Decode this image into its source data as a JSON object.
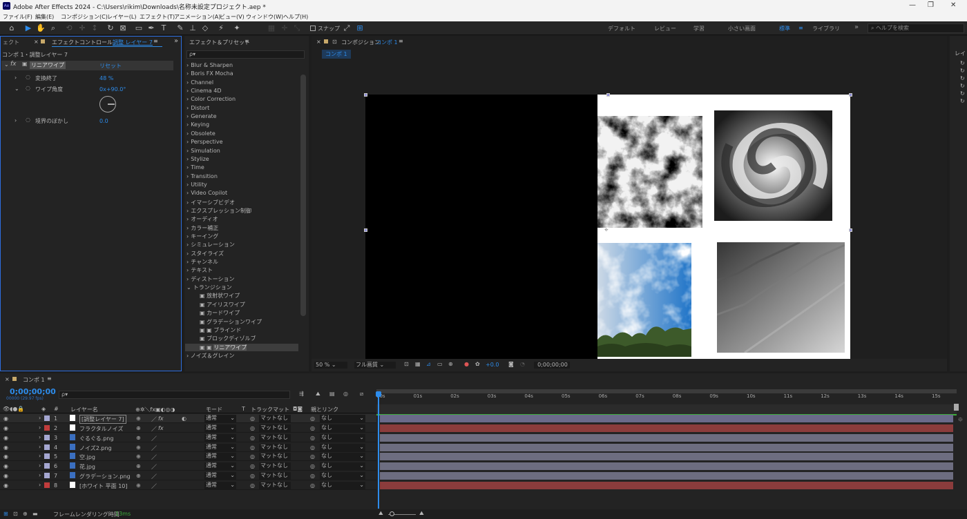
{
  "titlebar": {
    "app_icon": "Ae",
    "title": "Adobe After Effects 2024 - C:\\Users\\rikim\\Downloads\\名称未設定プロジェクト.aep *"
  },
  "menu": [
    "ファイル(F)",
    "編集(E)",
    "コンポジション(C)",
    "レイヤー(L)",
    "エフェクト(T)",
    "アニメーション(A)",
    "ビュー(V)",
    "ウィンドウ(W)",
    "ヘルプ(H)"
  ],
  "toolbar": {
    "snap_label": "スナップ",
    "workspaces": [
      "デフォルト",
      "レビュー",
      "学習",
      "小さい画面",
      "標準",
      "ライブラリ"
    ],
    "active_workspace": "標準",
    "help_placeholder": "ヘルプを検索"
  },
  "effect_controls": {
    "left_tab": "ェクト",
    "tab_label": "エフェクトコントロール",
    "tab_layer": "調整 レイヤー 7",
    "breadcrumb": "コンポ 1・調整レイヤー 7",
    "effect_name": "リニアワイプ",
    "reset": "リセット",
    "props": [
      {
        "name": "変換終了",
        "value": "48 %"
      },
      {
        "name": "ワイプ角度",
        "value": "0x+90.0°"
      },
      {
        "name": "境界のぼかし",
        "value": "0.0"
      }
    ]
  },
  "effects_presets": {
    "title": "エフェクト＆プリセット",
    "search_placeholder": "ρ▾",
    "categories": [
      "Blur & Sharpen",
      "Boris FX Mocha",
      "Channel",
      "Cinema 4D",
      "Color Correction",
      "Distort",
      "Generate",
      "Keying",
      "Obsolete",
      "Perspective",
      "Simulation",
      "Stylize",
      "Time",
      "Transition",
      "Utility",
      "Video Copilot",
      "イマーシブビデオ",
      "エクスプレッション制御",
      "オーディオ",
      "カラー補正",
      "キーイング",
      "シミュレーション",
      "スタイライズ",
      "チャンネル",
      "テキスト",
      "ディストーション",
      "トランジション"
    ],
    "transition_items": [
      "放射状ワイプ",
      "アイリスワイプ",
      "カードワイプ",
      "グラデーションワイプ",
      "ブラインド",
      "ブロックディゾルブ",
      "リニアワイプ"
    ],
    "last_category": "ノイズ＆グレイン"
  },
  "composition": {
    "panel_label": "コンポジション",
    "comp_name": "コンポ 1",
    "tab": "コンポ 1",
    "zoom": "50 %",
    "quality": "フル画質",
    "exposure": "+0.0",
    "timecode": "0;00;00;00"
  },
  "timeline": {
    "tab": "コンポ 1",
    "timecode": "0;00;00;00",
    "fps": "00000 (29.97 fps)",
    "search": "ρ▾",
    "headers": {
      "layer_name": "レイヤー名",
      "mode": "モード",
      "t": "T",
      "trackmatte": "トラックマット",
      "parent": "親とリンク",
      "hash": "#"
    },
    "ruler": [
      "00s",
      "01s",
      "02s",
      "03s",
      "04s",
      "05s",
      "06s",
      "07s",
      "08s",
      "09s",
      "10s",
      "11s",
      "12s",
      "13s",
      "14s",
      "15s"
    ],
    "layers": [
      {
        "num": "1",
        "name": "[調整レイヤー 7]",
        "color": "#a5a7d1",
        "mode": "通常",
        "matte": "マットなし",
        "parent": "なし",
        "bar": "#6a6a8a"
      },
      {
        "num": "2",
        "name": "フラクタルノイズ",
        "color": "#c03c3c",
        "mode": "通常",
        "matte": "マットなし",
        "parent": "なし",
        "bar": "#8b3c3c"
      },
      {
        "num": "3",
        "name": "ぐるぐる.png",
        "color": "#a5a7d1",
        "mode": "通常",
        "matte": "マットなし",
        "parent": "なし",
        "bar": "#6d6d80"
      },
      {
        "num": "4",
        "name": "ノイズ2.png",
        "color": "#a5a7d1",
        "mode": "通常",
        "matte": "マットなし",
        "parent": "なし",
        "bar": "#6d6d80"
      },
      {
        "num": "5",
        "name": "空.jpg",
        "color": "#a5a7d1",
        "mode": "通常",
        "matte": "マットなし",
        "parent": "なし",
        "bar": "#6d6d80"
      },
      {
        "num": "6",
        "name": "花.jpg",
        "color": "#a5a7d1",
        "mode": "通常",
        "matte": "マットなし",
        "parent": "なし",
        "bar": "#6d6d80"
      },
      {
        "num": "7",
        "name": "グラデーション.png",
        "color": "#a5a7d1",
        "mode": "通常",
        "matte": "マットなし",
        "parent": "なし",
        "bar": "#6d6d80"
      },
      {
        "num": "8",
        "name": "[ホワイト 平面 10]",
        "color": "#c03c3c",
        "mode": "通常",
        "matte": "マットなし",
        "parent": "なし",
        "bar": "#8b3c3c"
      }
    ]
  },
  "status": {
    "render_label": "フレームレンダリング時間",
    "render_time": "13ms"
  },
  "colors": {
    "accent": "#2d8ceb",
    "panel": "#232323"
  }
}
